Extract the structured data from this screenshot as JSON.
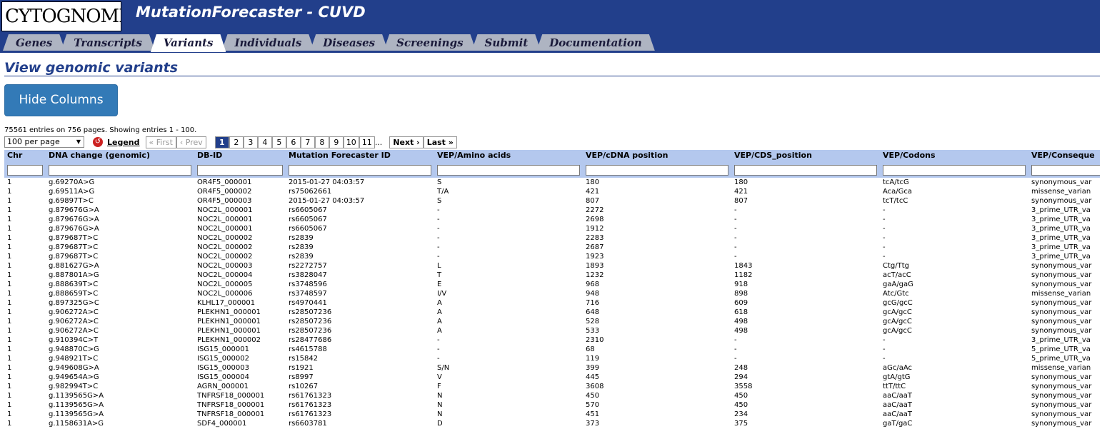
{
  "header": {
    "logo_text": "CYTOGNOMIX",
    "app_title": "MutationForecaster - CUVD"
  },
  "tabs": [
    {
      "label": "Genes",
      "active": false
    },
    {
      "label": "Transcripts",
      "active": false
    },
    {
      "label": "Variants",
      "active": true
    },
    {
      "label": "Individuals",
      "active": false
    },
    {
      "label": "Diseases",
      "active": false
    },
    {
      "label": "Screenings",
      "active": false
    },
    {
      "label": "Submit",
      "active": false
    },
    {
      "label": "Documentation",
      "active": false
    }
  ],
  "page": {
    "title": "View genomic variants",
    "hide_columns_label": "Hide Columns",
    "entries_text": "75561 entries on 756 pages. Showing entries 1 - 100."
  },
  "pagination": {
    "per_page": "100 per page",
    "legend_label": "Legend",
    "first_label": "« First",
    "prev_label": "‹ Prev",
    "pages": [
      "1",
      "2",
      "3",
      "4",
      "5",
      "6",
      "7",
      "8",
      "9",
      "10",
      "11"
    ],
    "current_page": "1",
    "ellipsis": "...",
    "next_label": "Next ›",
    "last_label": "Last »"
  },
  "colors": {
    "header_bg": "#223f8b",
    "table_header_bg": "#b4c8ee",
    "button_bg": "#337ab7"
  },
  "table": {
    "columns": [
      "Chr",
      "DNA change (genomic)",
      "DB-ID",
      "Mutation Forecaster ID",
      "VEP/Amino acids",
      "VEP/cDNA position",
      "VEP/CDS_position",
      "VEP/Codons",
      "VEP/Conseque"
    ],
    "rows": [
      [
        "1",
        "g.69270A>G",
        "OR4F5_000001",
        "2015-01-27 04:03:57",
        "S",
        "180",
        "180",
        "tcA/tcG",
        "synonymous_var"
      ],
      [
        "1",
        "g.69511A>G",
        "OR4F5_000002",
        "rs75062661",
        "T/A",
        "421",
        "421",
        "Aca/Gca",
        "missense_varian"
      ],
      [
        "1",
        "g.69897T>C",
        "OR4F5_000003",
        "2015-01-27 04:03:57",
        "S",
        "807",
        "807",
        "tcT/tcC",
        "synonymous_var"
      ],
      [
        "1",
        "g.879676G>A",
        "NOC2L_000001",
        "rs6605067",
        "-",
        "2272",
        "-",
        "-",
        "3_prime_UTR_va"
      ],
      [
        "1",
        "g.879676G>A",
        "NOC2L_000001",
        "rs6605067",
        "-",
        "2698",
        "-",
        "-",
        "3_prime_UTR_va"
      ],
      [
        "1",
        "g.879676G>A",
        "NOC2L_000001",
        "rs6605067",
        "-",
        "1912",
        "-",
        "-",
        "3_prime_UTR_va"
      ],
      [
        "1",
        "g.879687T>C",
        "NOC2L_000002",
        "rs2839",
        "-",
        "2283",
        "-",
        "-",
        "3_prime_UTR_va"
      ],
      [
        "1",
        "g.879687T>C",
        "NOC2L_000002",
        "rs2839",
        "-",
        "2687",
        "-",
        "-",
        "3_prime_UTR_va"
      ],
      [
        "1",
        "g.879687T>C",
        "NOC2L_000002",
        "rs2839",
        "-",
        "1923",
        "-",
        "-",
        "3_prime_UTR_va"
      ],
      [
        "1",
        "g.881627G>A",
        "NOC2L_000003",
        "rs2272757",
        "L",
        "1893",
        "1843",
        "Ctg/Ttg",
        "synonymous_var"
      ],
      [
        "1",
        "g.887801A>G",
        "NOC2L_000004",
        "rs3828047",
        "T",
        "1232",
        "1182",
        "acT/acC",
        "synonymous_var"
      ],
      [
        "1",
        "g.888639T>C",
        "NOC2L_000005",
        "rs3748596",
        "E",
        "968",
        "918",
        "gaA/gaG",
        "synonymous_var"
      ],
      [
        "1",
        "g.888659T>C",
        "NOC2L_000006",
        "rs3748597",
        "I/V",
        "948",
        "898",
        "Atc/Gtc",
        "missense_varian"
      ],
      [
        "1",
        "g.897325G>C",
        "KLHL17_000001",
        "rs4970441",
        "A",
        "716",
        "609",
        "gcG/gcC",
        "synonymous_var"
      ],
      [
        "1",
        "g.906272A>C",
        "PLEKHN1_000001",
        "rs28507236",
        "A",
        "648",
        "618",
        "gcA/gcC",
        "synonymous_var"
      ],
      [
        "1",
        "g.906272A>C",
        "PLEKHN1_000001",
        "rs28507236",
        "A",
        "528",
        "498",
        "gcA/gcC",
        "synonymous_var"
      ],
      [
        "1",
        "g.906272A>C",
        "PLEKHN1_000001",
        "rs28507236",
        "A",
        "533",
        "498",
        "gcA/gcC",
        "synonymous_var"
      ],
      [
        "1",
        "g.910394C>T",
        "PLEKHN1_000002",
        "rs28477686",
        "-",
        "2310",
        "-",
        "-",
        "3_prime_UTR_va"
      ],
      [
        "1",
        "g.948870C>G",
        "ISG15_000001",
        "rs4615788",
        "-",
        "68",
        "-",
        "-",
        "5_prime_UTR_va"
      ],
      [
        "1",
        "g.948921T>C",
        "ISG15_000002",
        "rs15842",
        "-",
        "119",
        "-",
        "-",
        "5_prime_UTR_va"
      ],
      [
        "1",
        "g.949608G>A",
        "ISG15_000003",
        "rs1921",
        "S/N",
        "399",
        "248",
        "aGc/aAc",
        "missense_varian"
      ],
      [
        "1",
        "g.949654A>G",
        "ISG15_000004",
        "rs8997",
        "V",
        "445",
        "294",
        "gtA/gtG",
        "synonymous_var"
      ],
      [
        "1",
        "g.982994T>C",
        "AGRN_000001",
        "rs10267",
        "F",
        "3608",
        "3558",
        "ttT/ttC",
        "synonymous_var"
      ],
      [
        "1",
        "g.1139565G>A",
        "TNFRSF18_000001",
        "rs61761323",
        "N",
        "450",
        "450",
        "aaC/aaT",
        "synonymous_var"
      ],
      [
        "1",
        "g.1139565G>A",
        "TNFRSF18_000001",
        "rs61761323",
        "N",
        "570",
        "450",
        "aaC/aaT",
        "synonymous_var"
      ],
      [
        "1",
        "g.1139565G>A",
        "TNFRSF18_000001",
        "rs61761323",
        "N",
        "451",
        "234",
        "aaC/aaT",
        "synonymous_var"
      ],
      [
        "1",
        "g.1158631A>G",
        "SDF4_000001",
        "rs6603781",
        "D",
        "373",
        "375",
        "gaT/gaC",
        "synonymous_var"
      ]
    ]
  }
}
